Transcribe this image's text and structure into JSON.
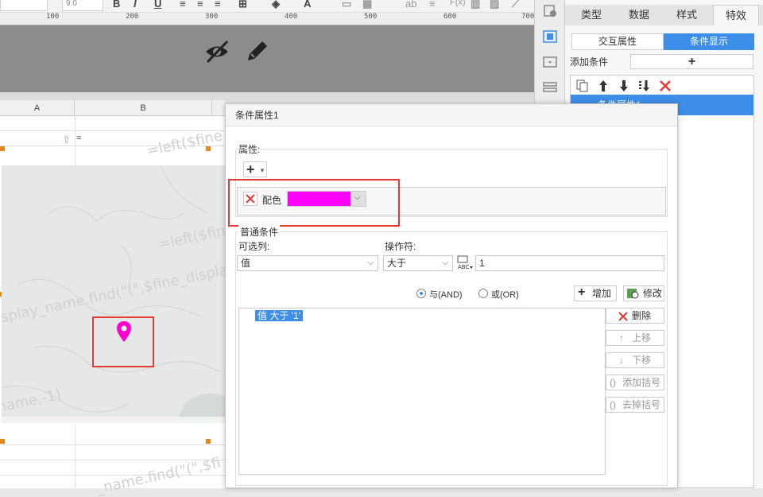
{
  "toolbar": {
    "font_size": "9.0",
    "icons": [
      "bold-icon",
      "italic-icon",
      "underline-icon",
      "align-left-icon",
      "align-center-icon",
      "align-right-icon",
      "border-icon",
      "fill-color-icon",
      "font-color-icon"
    ]
  },
  "ruler": {
    "ticks": [
      "100",
      "200",
      "300",
      "400",
      "500",
      "600",
      "700"
    ]
  },
  "right_panel": {
    "tabs": [
      "类型",
      "数据",
      "样式",
      "特效"
    ],
    "subtabs": [
      "交互属性",
      "条件显示"
    ],
    "add_condition_label": "添加条件",
    "add_button": "+",
    "condition_item": "条件属性1"
  },
  "sheet": {
    "col_a": "A",
    "col_b": "B",
    "cell_b1": "=",
    "watermarks": [
      "=left($fine",
      "=left($fine_displ",
      "splay_name.find(\"(\",$fine_display",
      "name,-1)",
      "_name.find(\"(\",$fi"
    ]
  },
  "dialog": {
    "title": "条件属性1",
    "attributes_label": "属性:",
    "attribute_name": "配色",
    "attribute_color": "#ff00ff",
    "condition_group": "普通条件",
    "column_label": "可选列:",
    "column_value": "值",
    "operator_label": "操作符:",
    "operator_value": "大于",
    "compare_value": "1",
    "and_label": "与(AND)",
    "or_label": "或(OR)",
    "add_label": "增加",
    "modify_label": "修改",
    "condition_text": "值 大于 '1'",
    "delete_label": "删除",
    "up_label": "上移",
    "down_label": "下移",
    "add_paren_label": "添加括号",
    "remove_paren_label": "去掉括号"
  },
  "colors": {
    "accent": "#3d8ee8",
    "highlight": "#e53935",
    "marker": "#ff00cc"
  }
}
